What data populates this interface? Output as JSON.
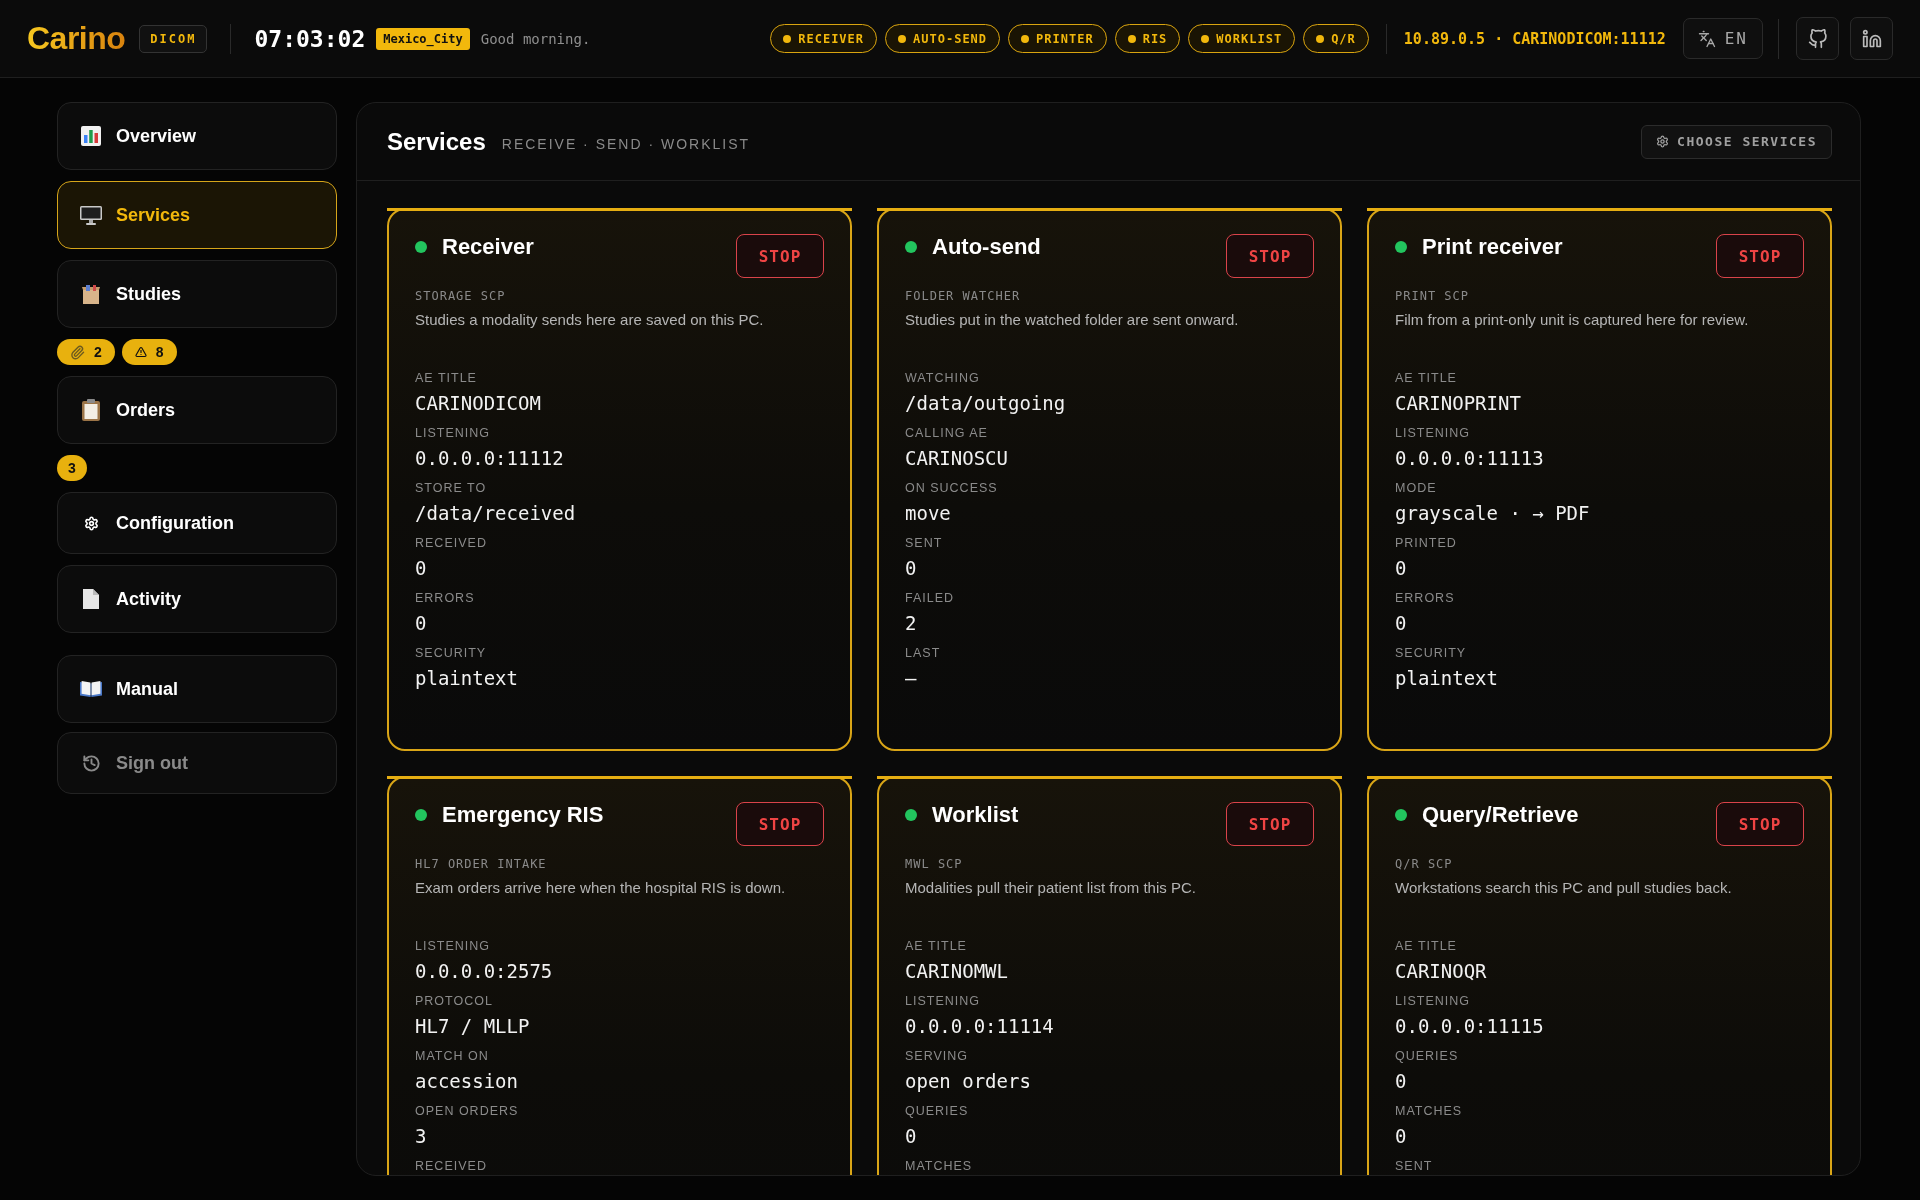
{
  "header": {
    "logo": "Carino",
    "product": "DICOM",
    "clock": "07:03:02",
    "timezone": "Mexico_City",
    "greeting": "Good morning.",
    "services": [
      {
        "label": "RECEIVER",
        "running": true
      },
      {
        "label": "AUTO-SEND",
        "running": true
      },
      {
        "label": "PRINTER",
        "running": true
      },
      {
        "label": "RIS",
        "running": true
      },
      {
        "label": "WORKLIST",
        "running": true
      },
      {
        "label": "Q/R",
        "running": true
      }
    ],
    "address": "10.89.0.5 · CARINODICOM:11112",
    "language": "EN"
  },
  "sidebar": {
    "items": [
      {
        "label": "Overview",
        "selected": false
      },
      {
        "label": "Services",
        "selected": true
      },
      {
        "label": "Studies",
        "selected": false,
        "badges": [
          {
            "kind": "attachments",
            "count": "2"
          },
          {
            "kind": "warnings",
            "count": "8"
          }
        ]
      },
      {
        "label": "Orders",
        "selected": false,
        "badges": [
          {
            "kind": "plain",
            "count": "3"
          }
        ]
      },
      {
        "label": "Configuration",
        "selected": false
      },
      {
        "label": "Activity",
        "selected": false
      }
    ],
    "footer": [
      {
        "label": "Manual",
        "kind": "link"
      },
      {
        "label": "Sign out",
        "kind": "signout"
      }
    ]
  },
  "panel": {
    "title": "Services",
    "subtitle": "RECEIVE · SEND · WORKLIST",
    "action": "CHOOSE SERVICES",
    "cards": [
      {
        "name": "Receiver",
        "running": true,
        "button": "STOP",
        "role": "STORAGE SCP",
        "description": "Studies a modality sends here are saved on this PC.",
        "fields": [
          {
            "label": "AE TITLE",
            "value": "CARINODICOM"
          },
          {
            "label": "LISTENING",
            "value": "0.0.0.0:11112"
          },
          {
            "label": "STORE TO",
            "value": "/data/received"
          },
          {
            "label": "RECEIVED",
            "value": "0"
          },
          {
            "label": "ERRORS",
            "value": "0"
          },
          {
            "label": "SECURITY",
            "value": "plaintext"
          }
        ]
      },
      {
        "name": "Auto-send",
        "running": true,
        "button": "STOP",
        "role": "FOLDER WATCHER",
        "description": "Studies put in the watched folder are sent onward.",
        "fields": [
          {
            "label": "WATCHING",
            "value": "/data/outgoing"
          },
          {
            "label": "CALLING AE",
            "value": "CARINOSCU"
          },
          {
            "label": "ON SUCCESS",
            "value": "move"
          },
          {
            "label": "SENT",
            "value": "0"
          },
          {
            "label": "FAILED",
            "value": "2"
          },
          {
            "label": "LAST",
            "value": "—"
          }
        ]
      },
      {
        "name": "Print receiver",
        "running": true,
        "button": "STOP",
        "role": "PRINT SCP",
        "description": "Film from a print-only unit is captured here for review.",
        "fields": [
          {
            "label": "AE TITLE",
            "value": "CARINOPRINT"
          },
          {
            "label": "LISTENING",
            "value": "0.0.0.0:11113"
          },
          {
            "label": "MODE",
            "value": "grayscale · → PDF"
          },
          {
            "label": "PRINTED",
            "value": "0"
          },
          {
            "label": "ERRORS",
            "value": "0"
          },
          {
            "label": "SECURITY",
            "value": "plaintext"
          }
        ]
      },
      {
        "name": "Emergency RIS",
        "running": true,
        "button": "STOP",
        "role": "HL7 ORDER INTAKE",
        "description": "Exam orders arrive here when the hospital RIS is down.",
        "fields": [
          {
            "label": "LISTENING",
            "value": "0.0.0.0:2575"
          },
          {
            "label": "PROTOCOL",
            "value": "HL7 / MLLP"
          },
          {
            "label": "MATCH ON",
            "value": "accession"
          },
          {
            "label": "OPEN ORDERS",
            "value": "3"
          },
          {
            "label": "RECEIVED"
          }
        ]
      },
      {
        "name": "Worklist",
        "running": true,
        "button": "STOP",
        "role": "MWL SCP",
        "description": "Modalities pull their patient list from this PC.",
        "fields": [
          {
            "label": "AE TITLE",
            "value": "CARINOMWL"
          },
          {
            "label": "LISTENING",
            "value": "0.0.0.0:11114"
          },
          {
            "label": "SERVING",
            "value": "open orders"
          },
          {
            "label": "QUERIES",
            "value": "0"
          },
          {
            "label": "MATCHES"
          }
        ]
      },
      {
        "name": "Query/Retrieve",
        "running": true,
        "button": "STOP",
        "role": "Q/R SCP",
        "description": "Workstations search this PC and pull studies back.",
        "fields": [
          {
            "label": "AE TITLE",
            "value": "CARINOQR"
          },
          {
            "label": "LISTENING",
            "value": "0.0.0.0:11115"
          },
          {
            "label": "QUERIES",
            "value": "0"
          },
          {
            "label": "MATCHES",
            "value": "0"
          },
          {
            "label": "SENT"
          }
        ]
      }
    ]
  }
}
